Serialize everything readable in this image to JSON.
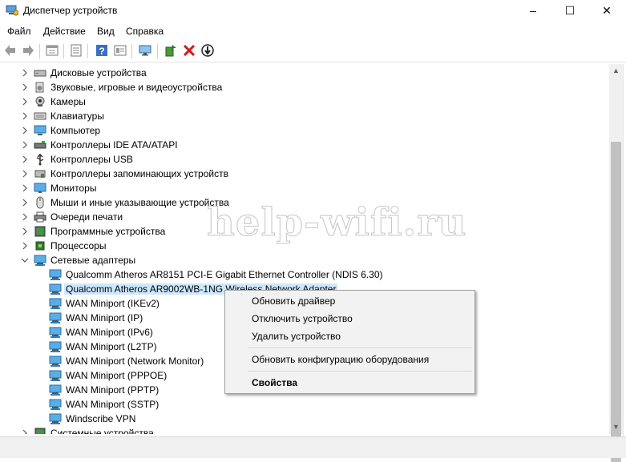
{
  "window": {
    "title": "Диспетчер устройств",
    "minimize": "–",
    "maximize": "☐",
    "close": "✕"
  },
  "menu": [
    "Файл",
    "Действие",
    "Вид",
    "Справка"
  ],
  "toolbar_icons": [
    "back-icon",
    "forward-icon",
    "properties-view-icon",
    "list-icon",
    "help-icon",
    "details-icon",
    "monitor-icon",
    "update-driver-icon",
    "uninstall-icon",
    "disable-icon"
  ],
  "tree": {
    "categories": [
      {
        "label": "Дисковые устройства",
        "icon": "disk-icon"
      },
      {
        "label": "Звуковые, игровые и видеоустройства",
        "icon": "audio-icon"
      },
      {
        "label": "Камеры",
        "icon": "camera-icon"
      },
      {
        "label": "Клавиатуры",
        "icon": "keyboard-icon"
      },
      {
        "label": "Компьютер",
        "icon": "computer-icon"
      },
      {
        "label": "Контроллеры IDE ATA/ATAPI",
        "icon": "ide-icon"
      },
      {
        "label": "Контроллеры USB",
        "icon": "usb-icon"
      },
      {
        "label": "Контроллеры запоминающих устройств",
        "icon": "storage-icon"
      },
      {
        "label": "Мониторы",
        "icon": "monitor-icon"
      },
      {
        "label": "Мыши и иные указывающие устройства",
        "icon": "mouse-icon"
      },
      {
        "label": "Очереди печати",
        "icon": "printer-icon"
      },
      {
        "label": "Программные устройства",
        "icon": "software-device-icon"
      },
      {
        "label": "Процессоры",
        "icon": "processor-icon"
      },
      {
        "label": "Сетевые адаптеры",
        "icon": "network-adapter-icon",
        "expanded": true
      }
    ],
    "network_adapters": [
      "Qualcomm Atheros AR8151 PCI-E Gigabit Ethernet Controller (NDIS 6.30)",
      "Qualcomm Atheros AR9002WB-1NG Wireless Network Adapter",
      "WAN Miniport (IKEv2)",
      "WAN Miniport (IP)",
      "WAN Miniport (IPv6)",
      "WAN Miniport (L2TP)",
      "WAN Miniport (Network Monitor)",
      "WAN Miniport (PPPOE)",
      "WAN Miniport (PPTP)",
      "WAN Miniport (SSTP)",
      "Windscribe VPN"
    ],
    "selected_adapter_index": 1,
    "last_category": "Системные устройства"
  },
  "context_menu": {
    "update_driver": "Обновить драйвер",
    "disable_device": "Отключить устройство",
    "uninstall_device": "Удалить устройство",
    "scan_hardware": "Обновить конфигурацию оборудования",
    "properties": "Свойства"
  },
  "watermark": "help-wifi.ru",
  "colors": {
    "selection": "#cce8ff",
    "menu_bg": "#f2f2f2",
    "network_icon": "#2a7fc9"
  }
}
